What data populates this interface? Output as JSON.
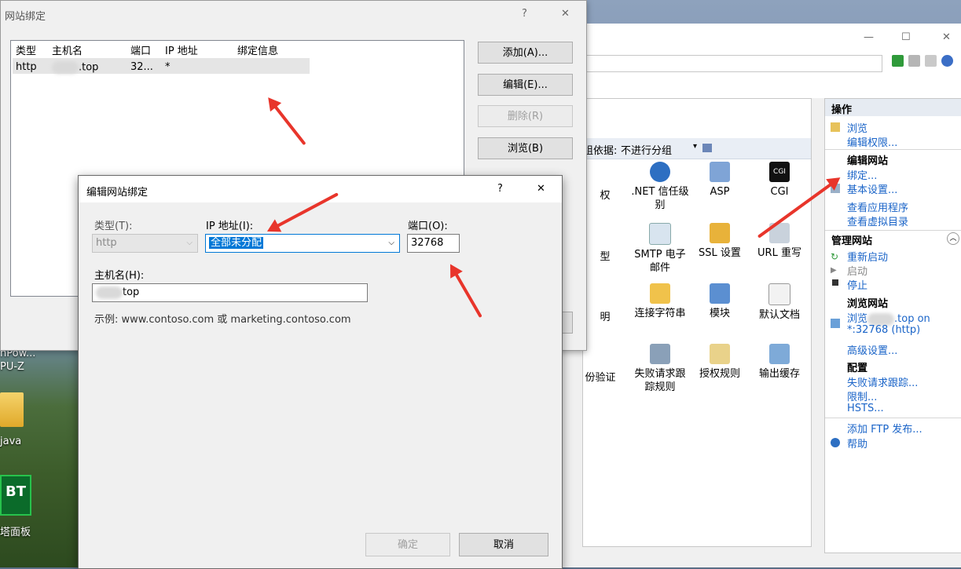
{
  "bindings_dialog": {
    "title": "网站绑定",
    "help_glyph": "?",
    "close_glyph": "✕",
    "columns": [
      "类型",
      "主机名",
      "端口",
      "IP 地址",
      "绑定信息"
    ],
    "row": {
      "type": "http",
      "host": ".top",
      "port": "32...",
      "ip": "*",
      "info": ""
    },
    "buttons": {
      "add": "添加(A)...",
      "edit": "编辑(E)...",
      "remove": "删除(R)",
      "browse": "浏览(B)"
    }
  },
  "edit_dialog": {
    "title": "编辑网站绑定",
    "help_glyph": "?",
    "close_glyph": "✕",
    "type_label": "类型(T):",
    "type_value": "http",
    "ip_label": "IP 地址(I):",
    "ip_value": "全部未分配",
    "port_label": "端口(O):",
    "port_value": "32768",
    "host_label": "主机名(H):",
    "host_value": "top",
    "example": "示例: www.contoso.com 或 marketing.contoso.com",
    "ok": "确定",
    "cancel": "取消"
  },
  "iis": {
    "min_glyph": "—",
    "max_glyph": "☐",
    "close_glyph": "✕",
    "group_label": "组依据:",
    "group_value": "不进行分组",
    "features": [
      {
        "label": "权",
        "icon": "auth-icon"
      },
      {
        "label": ".NET 信任级别",
        "icon": "net-trust-icon"
      },
      {
        "label": "ASP",
        "icon": "asp-icon"
      },
      {
        "label": "CGI",
        "icon": "cgi-icon"
      },
      {
        "label": "型",
        "icon": "type-icon"
      },
      {
        "label": "SMTP 电子邮件",
        "icon": "smtp-icon"
      },
      {
        "label": "SSL 设置",
        "icon": "ssl-icon"
      },
      {
        "label": "URL 重写",
        "icon": "url-rewrite-icon"
      },
      {
        "label": "明",
        "icon": "explain-icon"
      },
      {
        "label": "连接字符串",
        "icon": "connection-string-icon"
      },
      {
        "label": "模块",
        "icon": "modules-icon"
      },
      {
        "label": "默认文档",
        "icon": "default-doc-icon"
      },
      {
        "label": "份验证",
        "icon": "authentication-icon"
      },
      {
        "label": "失败请求跟踪规则",
        "icon": "failed-request-icon"
      },
      {
        "label": "授权规则",
        "icon": "authorization-icon"
      },
      {
        "label": "输出缓存",
        "icon": "output-cache-icon"
      }
    ],
    "actions": {
      "header": "操作",
      "browse": "浏览",
      "edit_perms": "编辑权限...",
      "edit_site": "编辑网站",
      "bindings": "绑定...",
      "basic_settings": "基本设置...",
      "view_apps": "查看应用程序",
      "view_vdirs": "查看虚拟目录",
      "manage_site": "管理网站",
      "restart": "重新启动",
      "start": "启动",
      "stop": "停止",
      "browse_site": "浏览网站",
      "browse_link_a": "浏览",
      "browse_link_b": ".top on",
      "browse_link_c": "*:32768 (http)",
      "advanced": "高级设置...",
      "config": "配置",
      "failed_trace": "失败请求跟踪...",
      "limits": "限制...",
      "hsts": "HSTS...",
      "add_ftp": "添加 FTP 发布...",
      "help": "帮助"
    }
  },
  "desktop": {
    "items": [
      "hPow...",
      "PU-Z",
      "java",
      "塔面板"
    ],
    "bt_logo": "BT"
  }
}
